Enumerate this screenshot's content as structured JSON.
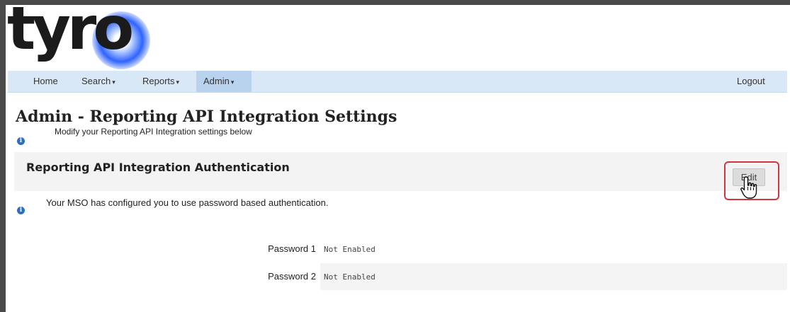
{
  "logo": {
    "text": "tyro"
  },
  "nav": {
    "items": [
      {
        "label": "Home",
        "has_menu": false,
        "active": false
      },
      {
        "label": "Search",
        "has_menu": true,
        "active": false
      },
      {
        "label": "Reports",
        "has_menu": true,
        "active": false
      },
      {
        "label": "Admin",
        "has_menu": true,
        "active": true
      }
    ],
    "caret": "▾",
    "logout_label": "Logout"
  },
  "page": {
    "title": "Admin - Reporting API Integration Settings",
    "subtitle": "Modify your Reporting API Integration settings below"
  },
  "section": {
    "title": "Reporting API Integration Authentication",
    "edit_label": "Edit",
    "auth_message": "Your MSO has configured you to use password based authentication."
  },
  "fields": [
    {
      "label": "Password 1",
      "value": "Not Enabled"
    },
    {
      "label": "Password 2",
      "value": "Not Enabled"
    }
  ],
  "icons": {
    "info": "info-icon",
    "cursor": "hand-pointer-icon",
    "info_glyph": "i"
  },
  "colors": {
    "navbar": "#d9e8f7",
    "nav_active": "#b9d2ee",
    "highlight": "#d4343e",
    "info": "#2e6fc0"
  }
}
